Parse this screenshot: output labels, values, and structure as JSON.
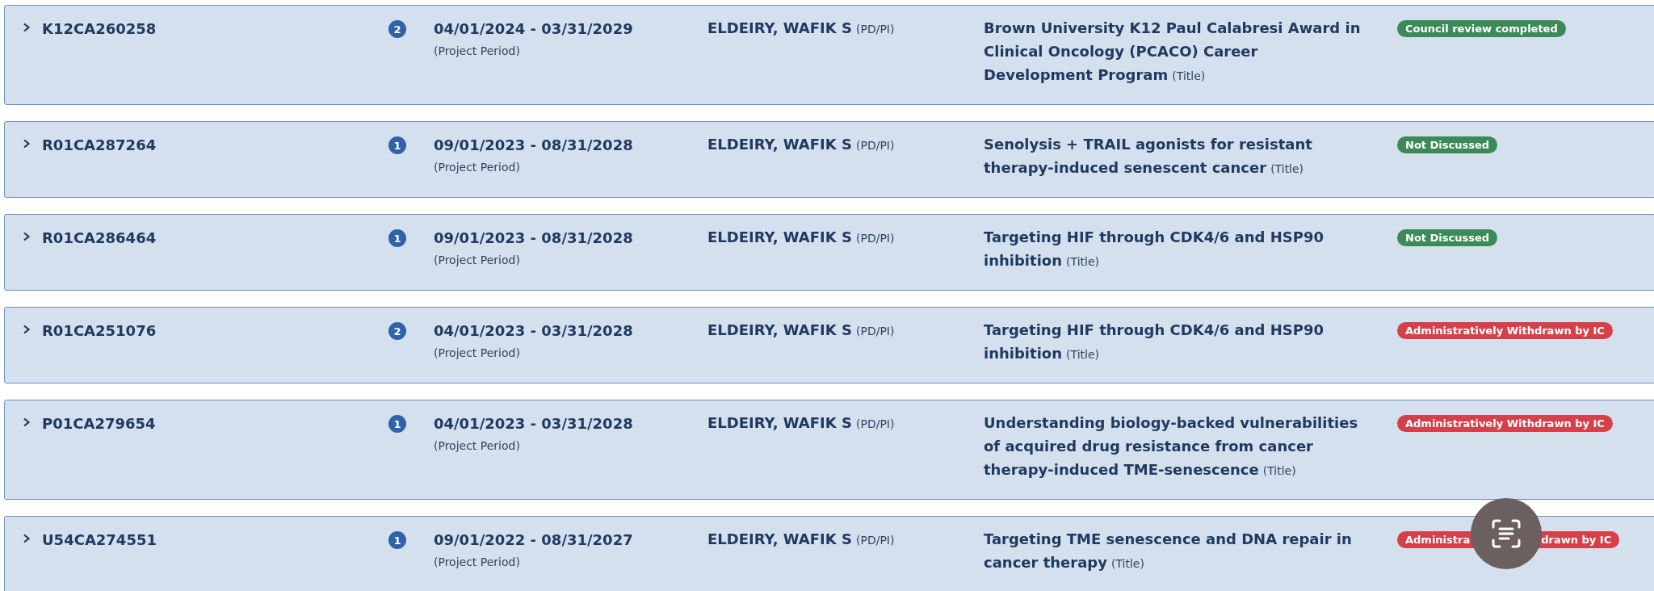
{
  "grants": [
    {
      "expanded": false,
      "id": "K12CA260258",
      "count": "2",
      "period": "04/01/2024 - 03/31/2029",
      "period_note": "(Project Period)",
      "investigator": "ELDEIRY, WAFIK S",
      "role": "(PD/PI)",
      "title": "Brown University K12 Paul Calabresi Award in Clinical Oncology (PCACO) Career Development Program",
      "title_note": "(Title)",
      "status": {
        "color": "#3b8a57",
        "segments": [
          "Council review completed"
        ]
      }
    },
    {
      "expanded": false,
      "id": "R01CA287264",
      "count": "1",
      "period": "09/01/2023 - 08/31/2028",
      "period_note": "(Project Period)",
      "investigator": "ELDEIRY, WAFIK S",
      "role": "(PD/PI)",
      "title": "Senolysis + TRAIL agonists for resistant therapy-induced senescent cancer",
      "title_note": "(Title)",
      "status": {
        "color": "#3b8a57",
        "segments": [
          "Not Discussed"
        ]
      }
    },
    {
      "expanded": false,
      "id": "R01CA286464",
      "count": "1",
      "period": "09/01/2023 - 08/31/2028",
      "period_note": "(Project Period)",
      "investigator": "ELDEIRY, WAFIK S",
      "role": "(PD/PI)",
      "title": "Targeting HIF through CDK4/6 and HSP90 inhibition",
      "title_note": "(Title)",
      "status": {
        "color": "#3b8a57",
        "segments": [
          "Not Discussed"
        ]
      }
    },
    {
      "expanded": false,
      "id": "R01CA251076",
      "count": "2",
      "period": "04/01/2023 - 03/31/2028",
      "period_note": "(Project Period)",
      "investigator": "ELDEIRY, WAFIK S",
      "role": "(PD/PI)",
      "title": "Targeting HIF through CDK4/6 and HSP90 inhibition",
      "title_note": "(Title)",
      "status": {
        "color": "#d6404b",
        "segments": [
          "Administratively Withdrawn by IC"
        ]
      }
    },
    {
      "expanded": false,
      "id": "P01CA279654",
      "count": "1",
      "period": "04/01/2023 - 03/31/2028",
      "period_note": "(Project Period)",
      "investigator": "ELDEIRY, WAFIK S",
      "role": "(PD/PI)",
      "title": "Understanding biology-backed vulnerabilities of acquired drug resistance from cancer therapy-induced TME-senescence",
      "title_note": "(Title)",
      "status": {
        "color": "#d6404b",
        "segments": [
          "Administratively Withdrawn by IC"
        ]
      }
    },
    {
      "expanded": false,
      "id": "U54CA274551",
      "count": "1",
      "period": "09/01/2022 - 08/31/2027",
      "period_note": "(Project Period)",
      "investigator": "ELDEIRY, WAFIK S",
      "role": "(PD/PI)",
      "title": "Targeting TME senescence and DNA repair in cancer therapy",
      "title_note": "(Title)",
      "status": {
        "color": "#d6404b",
        "segments": [
          "Administra",
          "drawn by IC"
        ]
      }
    }
  ],
  "live_text_button": true
}
